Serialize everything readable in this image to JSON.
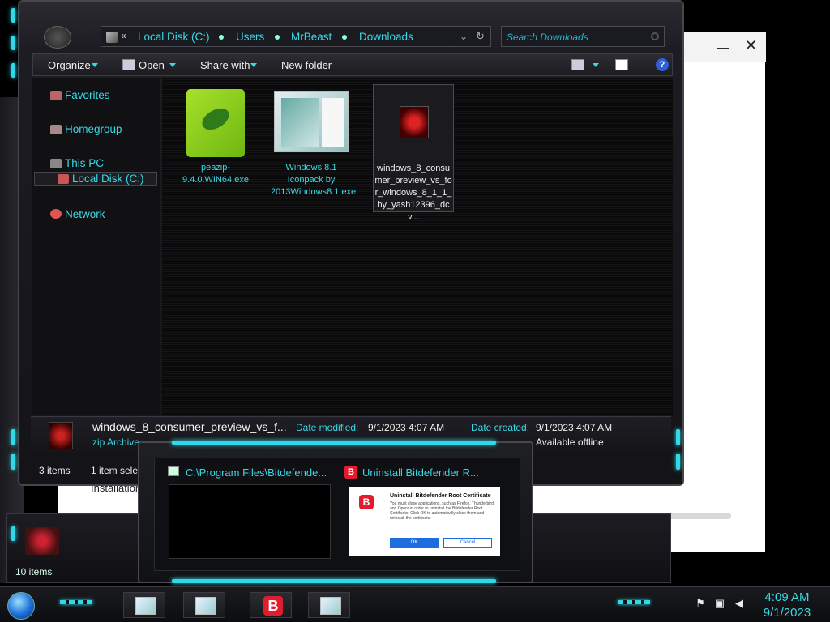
{
  "explorer": {
    "address": {
      "back_label": "«",
      "crumbs": [
        "Local Disk (C:)",
        "Users",
        "MrBeast",
        "Downloads"
      ],
      "search_placeholder": "Search Downloads"
    },
    "command_bar": {
      "organize": "Organize",
      "open": "Open",
      "share_with": "Share with",
      "new_folder": "New folder",
      "help": "?"
    },
    "nav": {
      "favorites": "Favorites",
      "homegroup": "Homegroup",
      "this_pc": "This PC",
      "local_disk": "Local Disk (C:)",
      "network": "Network"
    },
    "files": [
      {
        "name": "peazip-9.4.0.WIN64.exe"
      },
      {
        "name": "Windows 8.1 Iconpack by 2013Windows8.1.exe"
      },
      {
        "name": "windows_8_consumer_preview_vs_for_windows_8_1_1_by_yash12396_dcv..."
      }
    ],
    "details": {
      "name": "windows_8_consumer_preview_vs_f...",
      "type": "zip Archive",
      "date_modified_label": "Date modified:",
      "date_modified": "9/1/2023 4:07 AM",
      "date_created_label": "Date created:",
      "date_created": "9/1/2023 4:07 AM",
      "offline": "Available offline"
    },
    "status": {
      "items": "3 items",
      "selected": "1 item selec"
    }
  },
  "back_window": {
    "status_items": "10 items",
    "minimize": "—",
    "close": "✕"
  },
  "installer": {
    "label": "Installation",
    "progress_fraction": 1.0,
    "progress_fraction_right": 0.43
  },
  "preview": {
    "title_1": "C:\\Program Files\\Bitdefende...",
    "title_2": "Uninstall Bitdefender R...",
    "dialog": {
      "title": "Uninstall Bitdefender Root Certificate",
      "body": "You must close applications, such as Firefox, Thunderbird and Opera in order to uninstall the Bitdefender Root Certificate. Click OK to automatically close them and uninstall the certificate.",
      "ok": "OK",
      "cancel": "Cancel",
      "b": "B"
    }
  },
  "taskbar": {
    "bitdefender": "B",
    "time": "4:09 AM",
    "date": "9/1/2023"
  },
  "colors": {
    "accent": "#3ad8e6",
    "bitdefender_red": "#e31c2d",
    "progress_green": "#1faa3c"
  }
}
